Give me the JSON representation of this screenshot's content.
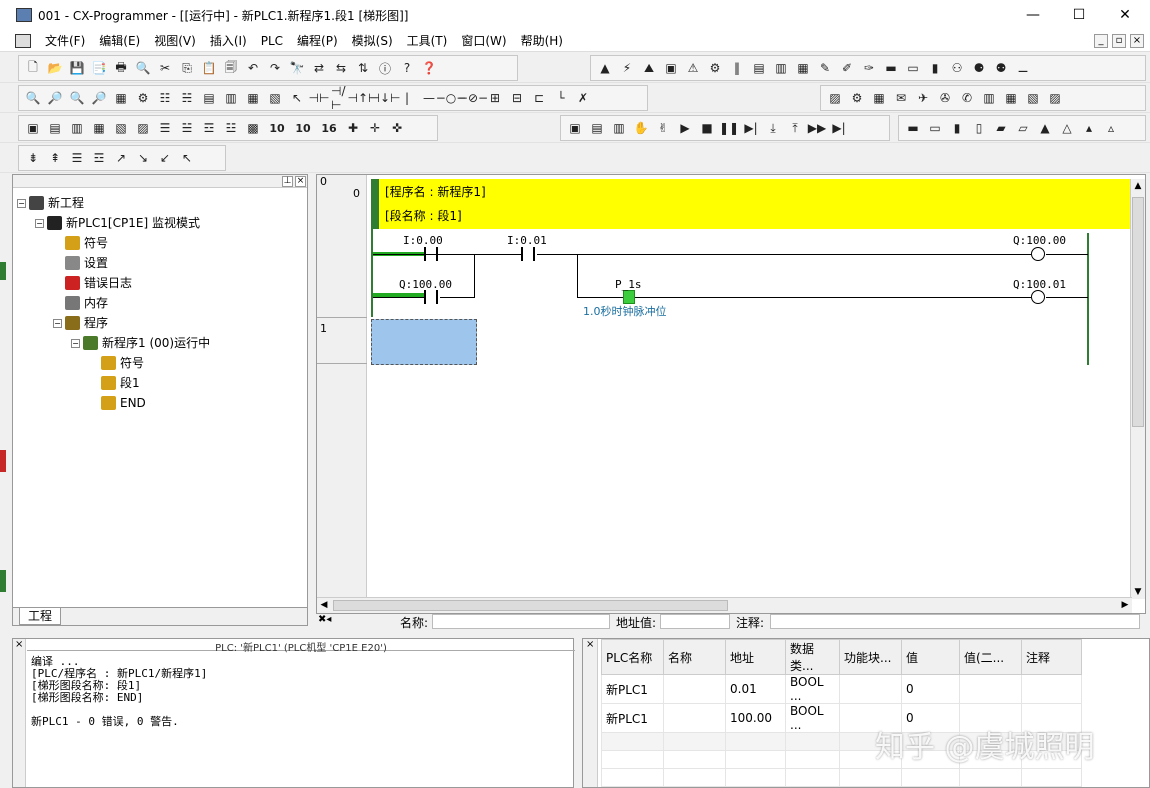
{
  "window": {
    "title": "001 - CX-Programmer - [[运行中] - 新PLC1.新程序1.段1 [梯形图]]",
    "controls": {
      "minimize": "—",
      "maximize": "☐",
      "close": "✕"
    }
  },
  "menu": [
    "文件(F)",
    "编辑(E)",
    "视图(V)",
    "插入(I)",
    "PLC",
    "编程(P)",
    "模拟(S)",
    "工具(T)",
    "窗口(W)",
    "帮助(H)"
  ],
  "toolbar": {
    "row1_a": [
      "🗋",
      "📂",
      "💾",
      "📑",
      "🖶",
      "🔍",
      "✂",
      "⎘",
      "📋",
      "🗐",
      "↶",
      "↷",
      "🔭",
      "⇄",
      "⇆",
      "⇅",
      "ⓘ",
      "?",
      "❓"
    ],
    "row1_b": [
      "▲",
      "⚡",
      "⛰",
      "▣",
      "⚠",
      "⚙",
      "‖",
      "▤",
      "▥",
      "▦",
      "✎",
      "✐",
      "✑",
      "▬",
      "▭",
      "▮",
      "⚇",
      "⚈",
      "⚉",
      "⚊"
    ],
    "row2_a": [
      "🔍",
      "🔎",
      "🔍",
      "🔎",
      "▦",
      "⚙",
      "☷",
      "☵",
      "▤",
      "▥",
      "▦",
      "▧",
      "↖",
      "⊣⊢",
      "⊣/⊢",
      "⊣↑⊢",
      "⊣↓⊢",
      "|",
      "—",
      "−○−",
      "−⊘−",
      "⊞",
      "⊟",
      "⊏",
      "└",
      "✗"
    ],
    "row2_b": [
      "▨",
      "⚙",
      "▦",
      "✉",
      "✈",
      "✇",
      "✆",
      "▥",
      "▦",
      "▧",
      "▨"
    ],
    "row3_a": [
      "▣",
      "▤",
      "▥",
      "▦",
      "▧",
      "▨",
      "☰",
      "☱",
      "☲",
      "☳",
      "▩",
      "10",
      "10",
      "16",
      "✚",
      "✛",
      "✜"
    ],
    "row3_b": [
      "▣",
      "▤",
      "▥",
      "✋",
      "✌",
      "▶",
      "■",
      "❚❚",
      "▶|",
      "⤓",
      "⤒",
      "▶▶",
      "▶|"
    ],
    "row3_c": [
      "▬",
      "▭",
      "▮",
      "▯",
      "▰",
      "▱",
      "▲",
      "△",
      "▴",
      "▵"
    ],
    "row4_a": [
      "⇟",
      "⇞",
      "☰",
      "☲",
      "↗",
      "↘",
      "↙",
      "↖"
    ]
  },
  "project_tree": {
    "items": [
      {
        "label": "新工程",
        "level": 0,
        "toggle": "−",
        "icon_color": "#444444"
      },
      {
        "label": "新PLC1[CP1E] 监视模式",
        "level": 1,
        "toggle": "−",
        "icon_color": "#222222"
      },
      {
        "label": "符号",
        "level": 2,
        "toggle": "",
        "icon_color": "#d4a017"
      },
      {
        "label": "设置",
        "level": 2,
        "toggle": "",
        "icon_color": "#888888"
      },
      {
        "label": "错误日志",
        "level": 2,
        "toggle": "",
        "icon_color": "#cc2222"
      },
      {
        "label": "内存",
        "level": 2,
        "toggle": "",
        "icon_color": "#777777"
      },
      {
        "label": "程序",
        "level": 2,
        "toggle": "−",
        "icon_color": "#8a6d1a"
      },
      {
        "label": "新程序1 (00)运行中",
        "level": 3,
        "toggle": "−",
        "icon_color": "#4a7a2a"
      },
      {
        "label": "符号",
        "level": 4,
        "toggle": "",
        "icon_color": "#d4a017"
      },
      {
        "label": "段1",
        "level": 4,
        "toggle": "",
        "icon_color": "#d4a017"
      },
      {
        "label": "END",
        "level": 4,
        "toggle": "",
        "icon_color": "#d4a017"
      }
    ],
    "tab_label": "工程"
  },
  "ladder": {
    "rung0_no": "0",
    "rung0_step": "0",
    "rung1_no": "1",
    "program_name": "[程序名 : 新程序1]",
    "section_name": "[段名称 : 段1]",
    "contact1": "I:0.00",
    "contact2": "I:0.01",
    "contact3": "Q:100.00",
    "coil1": "Q:100.00",
    "contact_p1s": "P_1s",
    "contact_p1s_comment": "1.0秒时钟脉冲位",
    "coil2": "Q:100.01",
    "colors": {
      "comment_bg": "#ffff00",
      "rail": "#2e7d32",
      "power_flow": "#22aa22",
      "cursor": "#9ec6ec"
    }
  },
  "statusbar": {
    "name_label": "名称:",
    "address_label": "地址值:",
    "comment_label": "注释:"
  },
  "output": {
    "header": "PLC: '新PLC1' (PLC机型 'CP1E E20')",
    "lines": [
      "编译 ...",
      "[PLC/程序名 : 新PLC1/新程序1]",
      "[梯形图段名称: 段1]",
      "[梯形图段名称: END]",
      "",
      "新PLC1 - 0 错误, 0 警告."
    ]
  },
  "watch": {
    "columns": [
      "PLC名称",
      "名称",
      "地址",
      "数据类...",
      "功能块...",
      "值",
      "值(二...",
      "注释"
    ],
    "rows": [
      [
        "新PLC1",
        "",
        "0.01",
        "BOOL ...",
        "",
        "0",
        "",
        ""
      ],
      [
        "新PLC1",
        "",
        "100.00",
        "BOOL ...",
        "",
        "0",
        "",
        ""
      ]
    ]
  },
  "watermark": "知乎 @虞城照明"
}
